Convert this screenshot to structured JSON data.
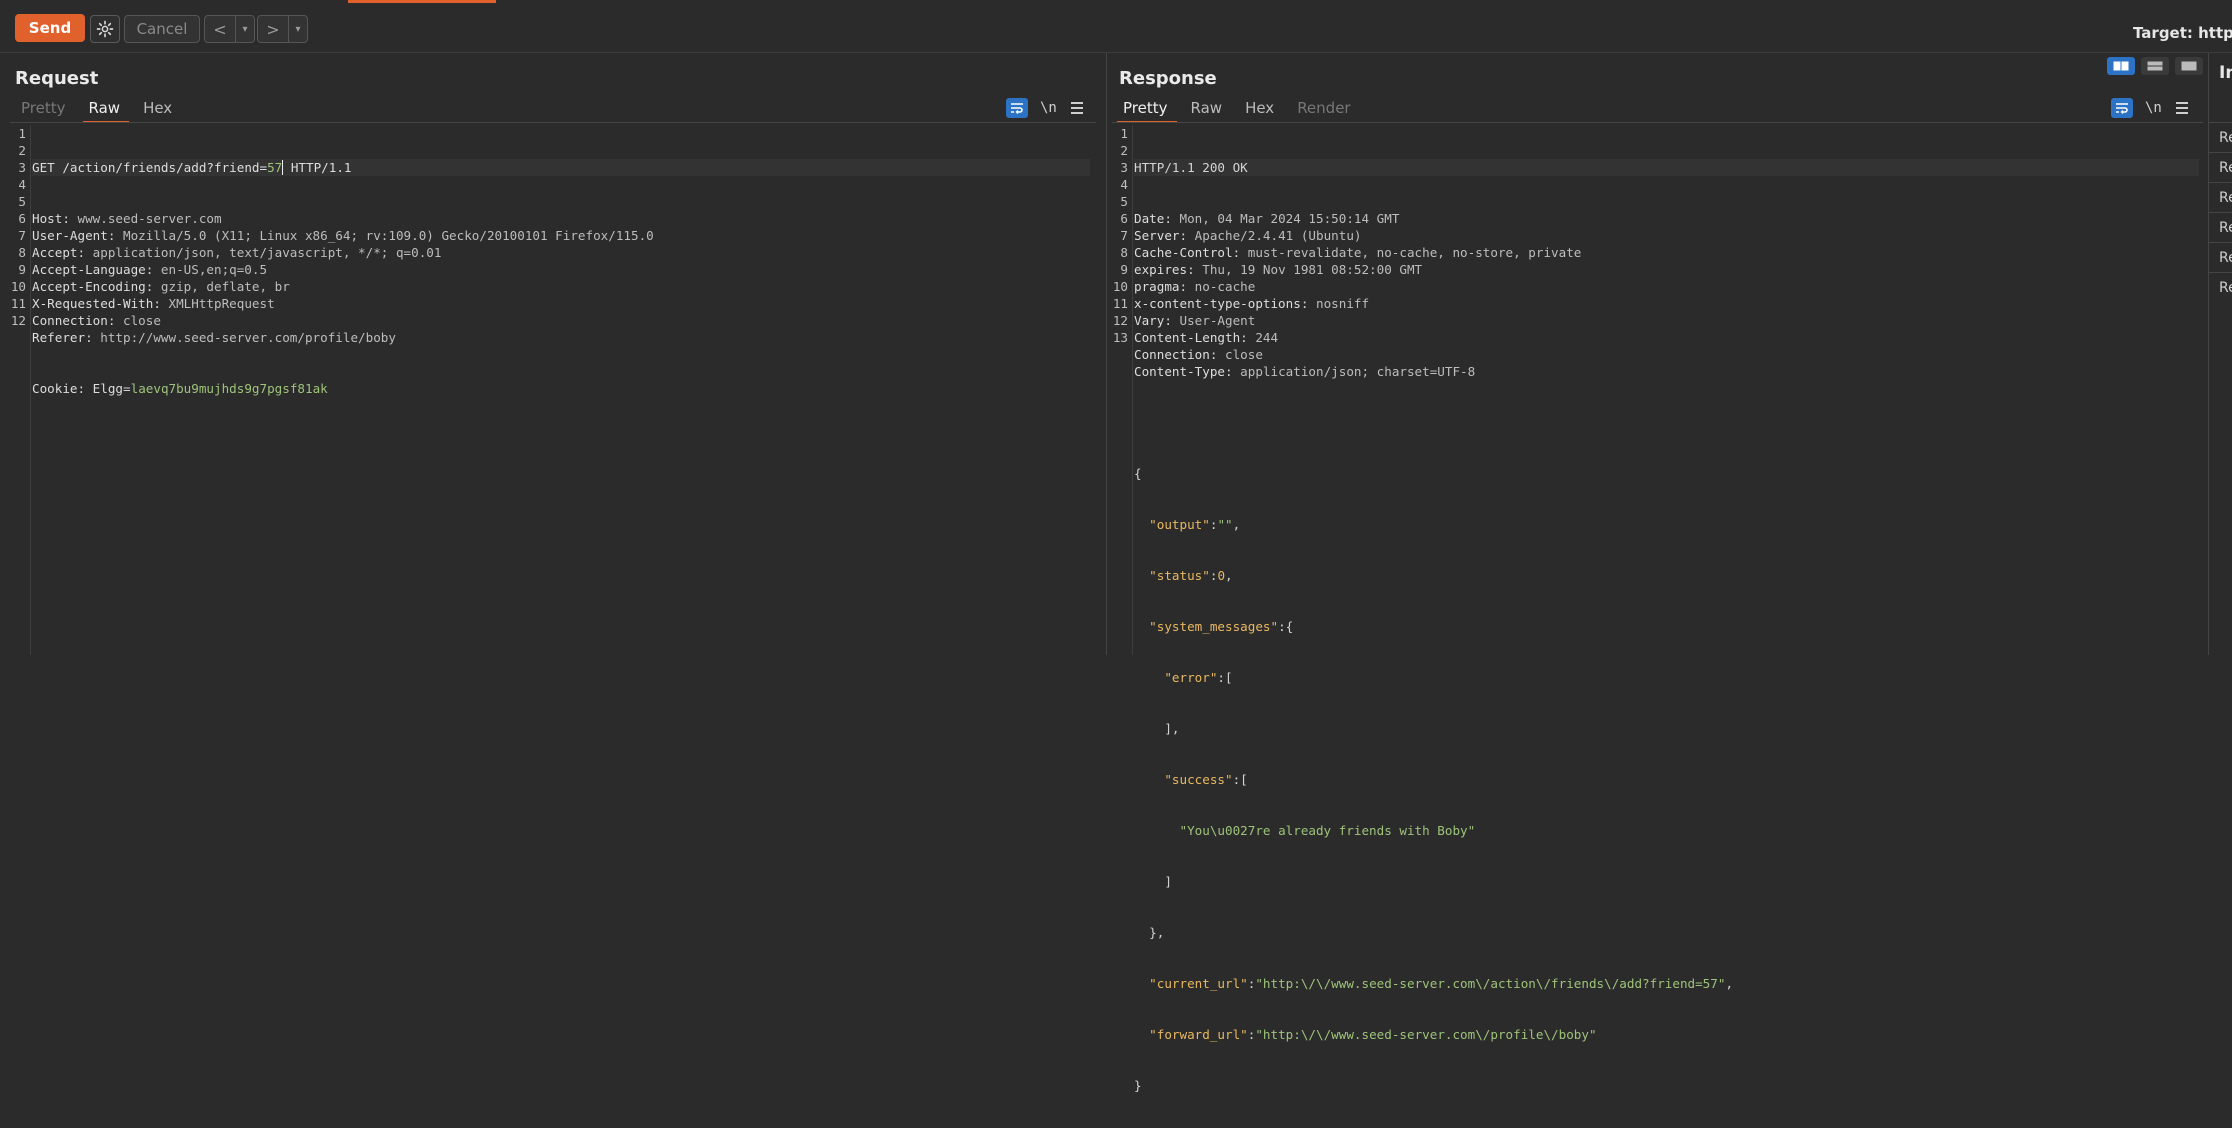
{
  "toolbar": {
    "send_label": "Send",
    "cancel_label": "Cancel",
    "back_label": "<",
    "forward_label": ">",
    "target_label": "Target: http://"
  },
  "request": {
    "title": "Request",
    "tabs": [
      "Pretty",
      "Raw",
      "Hex"
    ],
    "active_tab": "Raw",
    "line_numbers": [
      "1",
      "2",
      "3",
      "4",
      "5",
      "6",
      "7",
      "8",
      "9",
      "10",
      "11",
      "12"
    ],
    "request_line": {
      "method": "GET",
      "path_prefix": "/action/friends/add?friend=",
      "path_value": "57",
      "version": "HTTP/1.1"
    },
    "headers": [
      {
        "name": "Host",
        "value": "www.seed-server.com"
      },
      {
        "name": "User-Agent",
        "value": "Mozilla/5.0 (X11; Linux x86_64; rv:109.0) Gecko/20100101 Firefox/115.0"
      },
      {
        "name": "Accept",
        "value": "application/json, text/javascript, */*; q=0.01"
      },
      {
        "name": "Accept-Language",
        "value": "en-US,en;q=0.5"
      },
      {
        "name": "Accept-Encoding",
        "value": "gzip, deflate, br"
      },
      {
        "name": "X-Requested-With",
        "value": "XMLHttpRequest"
      },
      {
        "name": "Connection",
        "value": "close"
      },
      {
        "name": "Referer",
        "value": "http://www.seed-server.com/profile/boby"
      }
    ],
    "cookie": {
      "name": "Cookie",
      "cookie_name": "Elgg",
      "cookie_value": "laevq7bu9mujhds9g7pgsf81ak"
    }
  },
  "response": {
    "title": "Response",
    "tabs": [
      "Pretty",
      "Raw",
      "Hex",
      "Render"
    ],
    "active_tab": "Pretty",
    "line_numbers": [
      "1",
      "2",
      "3",
      "4",
      "5",
      "6",
      "7",
      "8",
      "9",
      "10",
      "11",
      "12",
      "13"
    ],
    "status_line": "HTTP/1.1 200 OK",
    "headers": [
      {
        "name": "Date",
        "value": "Mon, 04 Mar 2024 15:50:14 GMT"
      },
      {
        "name": "Server",
        "value": "Apache/2.4.41 (Ubuntu)"
      },
      {
        "name": "Cache-Control",
        "value": "must-revalidate, no-cache, no-store, private"
      },
      {
        "name": "expires",
        "value": "Thu, 19 Nov 1981 08:52:00 GMT"
      },
      {
        "name": "pragma",
        "value": "no-cache"
      },
      {
        "name": "x-content-type-options",
        "value": "nosniff"
      },
      {
        "name": "Vary",
        "value": "User-Agent"
      },
      {
        "name": "Content-Length",
        "value": "244"
      },
      {
        "name": "Connection",
        "value": "close"
      },
      {
        "name": "Content-Type",
        "value": "application/json; charset=UTF-8"
      }
    ],
    "json": {
      "output_key": "\"output\"",
      "output_val": "\"\"",
      "status_key": "\"status\"",
      "status_val": "0",
      "sysmsg_key": "\"system_messages\"",
      "error_key": "\"error\"",
      "success_key": "\"success\"",
      "success_msg": "\"You\\u0027re already friends with Boby\"",
      "current_url_key": "\"current_url\"",
      "current_url_val": "\"http:\\/\\/www.seed-server.com\\/action\\/friends\\/add?friend=57\"",
      "forward_url_key": "\"forward_url\"",
      "forward_url_val": "\"http:\\/\\/www.seed-server.com\\/profile\\/boby\""
    }
  },
  "inspector": {
    "title": "In",
    "items": [
      "Re",
      "Re",
      "Re",
      "Re",
      "Re",
      "Re"
    ]
  },
  "colors": {
    "accent": "#e0612b",
    "blue": "#2d73c5",
    "green": "#9ec37a",
    "amber": "#e8b860"
  }
}
